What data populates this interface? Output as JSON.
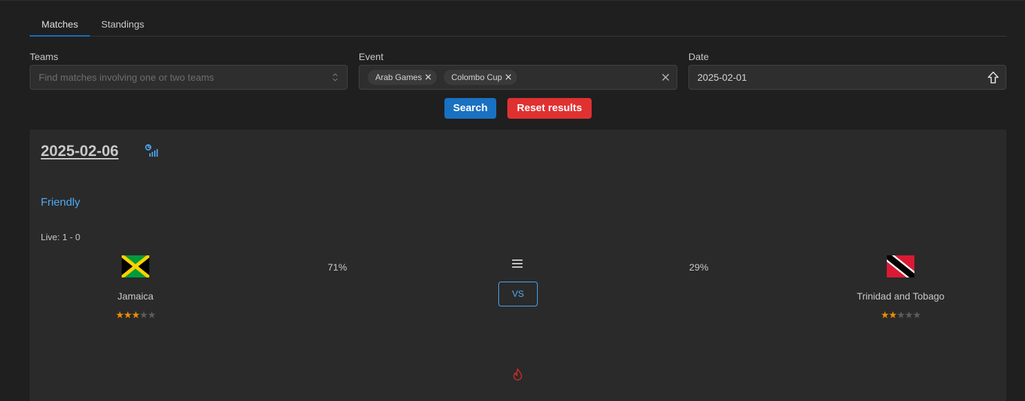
{
  "tabs": [
    {
      "label": "Matches",
      "active": true
    },
    {
      "label": "Standings",
      "active": false
    }
  ],
  "filters": {
    "teams": {
      "label": "Teams",
      "placeholder": "Find matches involving one or two teams",
      "icon": "chevron-updown-icon"
    },
    "event": {
      "label": "Event",
      "selected": [
        "Arab Games",
        "Colombo Cup"
      ],
      "clear_icon": "close-icon"
    },
    "date": {
      "label": "Date",
      "value": "2025-02-01",
      "icon": "arrow-up-icon"
    }
  },
  "actions": {
    "search_label": "Search",
    "reset_label": "Reset results"
  },
  "match": {
    "date": "2025-02-06",
    "stats_icon": "stats-chart-icon",
    "event": "Friendly",
    "live": "Live: 1 - 0",
    "home": {
      "name": "Jamaica",
      "flag": "jamaica-flag",
      "win_pct": "71%",
      "rating": 3,
      "rating_max": 5
    },
    "away": {
      "name": "Trinidad and Tobago",
      "flag": "trinidad-and-tobago-flag",
      "win_pct": "29%",
      "rating": 2,
      "rating_max": 5
    },
    "menu_icon": "menu-icon",
    "vs_label": "VS",
    "flame_icon": "flame-icon"
  },
  "colors": {
    "accent": "#1971c2",
    "danger": "#e03131",
    "link": "#4dabf7",
    "star": "#f08c00",
    "flame": "#c92a2a"
  }
}
